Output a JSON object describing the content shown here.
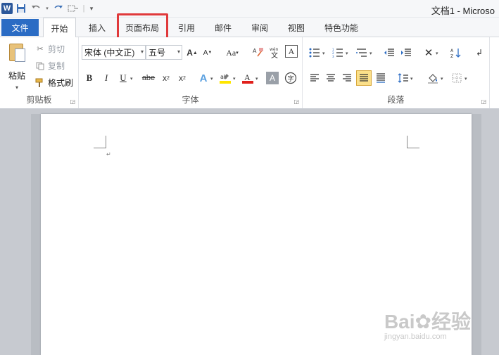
{
  "title_bar": {
    "doc_title": "文档1 - Microso"
  },
  "tabs": [
    "文件",
    "开始",
    "插入",
    "页面布局",
    "引用",
    "邮件",
    "审阅",
    "视图",
    "特色功能"
  ],
  "clipboard": {
    "paste": "粘贴",
    "cut": "剪切",
    "copy": "复制",
    "format_painter": "格式刷",
    "label": "剪贴板"
  },
  "font": {
    "name": "宋体 (中文正)",
    "size": "五号",
    "label": "字体"
  },
  "paragraph": {
    "label": "段落"
  },
  "watermark": {
    "brand": "Bai",
    "brand2": "经验",
    "url": "jingyan.baidu.com"
  },
  "colors": {
    "file_tab": "#2b6cc4",
    "highlight_box": "#e0393b",
    "active_align": "#fbe08a"
  }
}
